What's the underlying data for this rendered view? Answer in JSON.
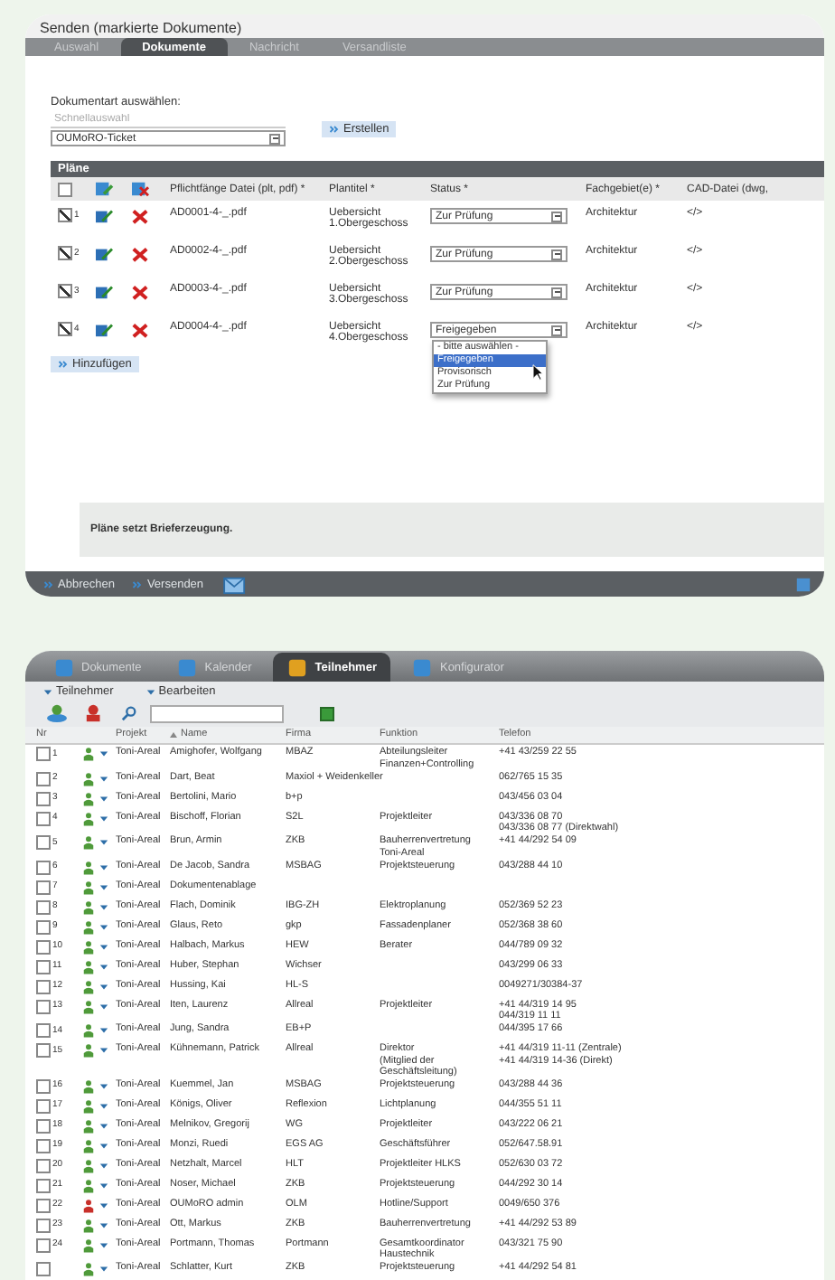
{
  "send_dialog": {
    "title": "Senden (markierte Dokumente)",
    "tabs": [
      {
        "label": "Auswahl",
        "selected": false
      },
      {
        "label": "Dokumente",
        "selected": true
      },
      {
        "label": "Nachricht",
        "selected": false
      },
      {
        "label": "Versandliste",
        "selected": false
      }
    ],
    "doc_type_label": "Dokumentart auswählen:",
    "quick_select": {
      "placeholder": "Schnellauswahl"
    },
    "doc_type_value": "OUMoRO-Ticket",
    "create_button": "Erstellen",
    "plans": {
      "title": "Pläne",
      "select_all_checked": false,
      "columns": [
        "Pflichtfänge Datei (plt, pdf) *",
        "Plantitel *",
        "Status *",
        "Fachgebiet(e) *",
        "CAD-Datei (dwg,"
      ],
      "rows": [
        {
          "checked": true,
          "nr": "1",
          "file": "AD0001-4-_.pdf",
          "title": [
            "Uebersicht",
            "1.Obergeschoss"
          ],
          "status": "Zur Prüfung",
          "field": "Architektur",
          "cad": "</>"
        },
        {
          "checked": true,
          "nr": "2",
          "file": "AD0002-4-_.pdf",
          "title": [
            "Uebersicht",
            "2.Obergeschoss"
          ],
          "status": "Zur Prüfung",
          "field": "Architektur",
          "cad": "</>"
        },
        {
          "checked": true,
          "nr": "3",
          "file": "AD0003-4-_.pdf",
          "title": [
            "Uebersicht",
            "3.Obergeschoss"
          ],
          "status": "Zur Prüfung",
          "field": "Architektur",
          "cad": "</>"
        },
        {
          "checked": true,
          "nr": "4",
          "file": "AD0004-4-_.pdf",
          "title": [
            "Uebersicht",
            "4.Obergeschoss"
          ],
          "status": "Freigegeben",
          "field": "Architektur",
          "cad": "</>"
        }
      ],
      "open_dropdown": {
        "options": [
          {
            "label": "- bitte auswählen -",
            "selected": false
          },
          {
            "label": "Freigegeben",
            "selected": true
          },
          {
            "label": "Provisorisch",
            "selected": false
          },
          {
            "label": "Zur Prüfung",
            "selected": false
          }
        ]
      },
      "add_button": "Hinzufügen"
    },
    "note": "Pläne setzt Brieferzeugung.",
    "footer_buttons": [
      "Abbrechen",
      "Versenden"
    ]
  },
  "participants": {
    "tabs": [
      {
        "label": "Dokumente",
        "selected": false
      },
      {
        "label": "Kalender",
        "selected": false
      },
      {
        "label": "Teilnehmer",
        "selected": true
      },
      {
        "label": "Konfigurator",
        "selected": false
      }
    ],
    "menus": [
      "Teilnehmer",
      "Bearbeiten"
    ],
    "columns": [
      "Nr",
      "Projekt",
      "Name",
      "Firma",
      "Funktion",
      "Telefon"
    ],
    "rows": [
      {
        "checked": false,
        "nr": "1",
        "color": "#4f9a3a",
        "project": "Toni-Areal",
        "name": "Amighofer, Wolfgang",
        "company": "MBAZ",
        "function": [
          "Abteilungsleiter",
          "Finanzen+Controlling"
        ],
        "phone": [
          "+41 43/259 22 55"
        ]
      },
      {
        "checked": false,
        "nr": "2",
        "color": "#4f9a3a",
        "project": "Toni-Areal",
        "name": "Dart, Beat",
        "company": "Maxiol + Weidenkeller",
        "function": [],
        "phone": [
          "062/765 15 35"
        ]
      },
      {
        "checked": false,
        "nr": "3",
        "color": "#4f9a3a",
        "project": "Toni-Areal",
        "name": "Bertolini, Mario",
        "company": "b+p",
        "function": [],
        "phone": [
          "043/456 03 04"
        ]
      },
      {
        "checked": false,
        "nr": "4",
        "color": "#4f9a3a",
        "project": "Toni-Areal",
        "name": "Bischoff, Florian",
        "company": "S2L",
        "function": [
          "Projektleiter"
        ],
        "phone": [
          "043/336 08 70",
          "043/336 08 77 (Direktwahl)"
        ]
      },
      {
        "checked": false,
        "nr": "5",
        "color": "#4f9a3a",
        "project": "Toni-Areal",
        "name": "Brun, Armin",
        "company": "ZKB",
        "function": [
          "Bauherrenvertretung",
          "Toni-Areal"
        ],
        "phone": [
          "+41 44/292 54 09"
        ]
      },
      {
        "checked": false,
        "nr": "6",
        "color": "#4f9a3a",
        "project": "Toni-Areal",
        "name": "De Jacob, Sandra",
        "company": "MSBAG",
        "function": [
          "Projektsteuerung"
        ],
        "phone": [
          "043/288 44 10"
        ]
      },
      {
        "checked": false,
        "nr": "7",
        "color": "#4f9a3a",
        "project": "Toni-Areal",
        "name": "Dokumentenablage",
        "company": "",
        "function": [],
        "phone": []
      },
      {
        "checked": false,
        "nr": "8",
        "color": "#4f9a3a",
        "project": "Toni-Areal",
        "name": "Flach, Dominik",
        "company": "IBG-ZH",
        "function": [
          "Elektroplanung"
        ],
        "phone": [
          "052/369 52 23"
        ]
      },
      {
        "checked": false,
        "nr": "9",
        "color": "#4f9a3a",
        "project": "Toni-Areal",
        "name": "Glaus, Reto",
        "company": "gkp",
        "function": [
          "Fassadenplaner"
        ],
        "phone": [
          "052/368 38 60"
        ]
      },
      {
        "checked": false,
        "nr": "10",
        "color": "#4f9a3a",
        "project": "Toni-Areal",
        "name": "Halbach, Markus",
        "company": "HEW",
        "function": [
          "Berater"
        ],
        "phone": [
          "044/789 09 32"
        ]
      },
      {
        "checked": false,
        "nr": "11",
        "color": "#4f9a3a",
        "project": "Toni-Areal",
        "name": "Huber, Stephan",
        "company": "Wichser",
        "function": [],
        "phone": [
          "043/299 06 33"
        ]
      },
      {
        "checked": false,
        "nr": "12",
        "color": "#4f9a3a",
        "project": "Toni-Areal",
        "name": "Hussing, Kai",
        "company": "HL-S",
        "function": [],
        "phone": [
          "0049271/30384-37"
        ]
      },
      {
        "checked": false,
        "nr": "13",
        "color": "#4f9a3a",
        "project": "Toni-Areal",
        "name": "Iten, Laurenz",
        "company": "Allreal",
        "function": [
          "Projektleiter"
        ],
        "phone": [
          "+41 44/319 14 95",
          "044/319 11 11"
        ]
      },
      {
        "checked": false,
        "nr": "14",
        "color": "#4f9a3a",
        "project": "Toni-Areal",
        "name": "Jung, Sandra",
        "company": "EB+P",
        "function": [],
        "phone": [
          "044/395 17 66"
        ]
      },
      {
        "checked": false,
        "nr": "15",
        "color": "#4f9a3a",
        "project": "Toni-Areal",
        "name": "Kühnemann, Patrick",
        "company": "Allreal",
        "function": [
          "Direktor",
          "(Mitglied der",
          "Geschäftsleitung)"
        ],
        "phone": [
          "+41 44/319 11-11 (Zentrale)",
          "+41 44/319 14-36 (Direkt)"
        ]
      },
      {
        "checked": false,
        "nr": "16",
        "color": "#4f9a3a",
        "project": "Toni-Areal",
        "name": "Kuemmel, Jan",
        "company": "MSBAG",
        "function": [
          "Projektsteuerung"
        ],
        "phone": [
          "043/288 44 36"
        ]
      },
      {
        "checked": false,
        "nr": "17",
        "color": "#4f9a3a",
        "project": "Toni-Areal",
        "name": "Königs, Oliver",
        "company": "Reflexion",
        "function": [
          "Lichtplanung"
        ],
        "phone": [
          "044/355 51 11"
        ]
      },
      {
        "checked": false,
        "nr": "18",
        "color": "#4f9a3a",
        "project": "Toni-Areal",
        "name": "Melnikov, Gregorij",
        "company": "WG",
        "function": [
          "Projektleiter"
        ],
        "phone": [
          "043/222 06 21"
        ]
      },
      {
        "checked": false,
        "nr": "19",
        "color": "#4f9a3a",
        "project": "Toni-Areal",
        "name": "Monzi, Ruedi",
        "company": "EGS AG",
        "function": [
          "Geschäftsführer"
        ],
        "phone": [
          "052/647.58.91"
        ]
      },
      {
        "checked": false,
        "nr": "20",
        "color": "#4f9a3a",
        "project": "Toni-Areal",
        "name": "Netzhalt, Marcel",
        "company": "HLT",
        "function": [
          "Projektleiter HLKS"
        ],
        "phone": [
          "052/630 03 72"
        ]
      },
      {
        "checked": false,
        "nr": "21",
        "color": "#4f9a3a",
        "project": "Toni-Areal",
        "name": "Noser, Michael",
        "company": "ZKB",
        "function": [
          "Projektsteuerung"
        ],
        "phone": [
          "044/292 30 14"
        ]
      },
      {
        "checked": false,
        "nr": "22",
        "color": "#c8302a",
        "project": "Toni-Areal",
        "name": "OUMoRO admin",
        "company": "OLM",
        "function": [
          "Hotline/Support"
        ],
        "phone": [
          "0049/650 376"
        ]
      },
      {
        "checked": false,
        "nr": "23",
        "color": "#4f9a3a",
        "project": "Toni-Areal",
        "name": "Ott, Markus",
        "company": "ZKB",
        "function": [
          "Bauherrenvertretung"
        ],
        "phone": [
          "+41 44/292 53 89"
        ]
      },
      {
        "checked": false,
        "nr": "24",
        "color": "#4f9a3a",
        "project": "Toni-Areal",
        "name": "Portmann, Thomas",
        "company": "Portmann",
        "function": [
          "Gesamtkoordinator",
          "Haustechnik"
        ],
        "phone": [
          "043/321 75 90"
        ]
      },
      {
        "checked": false,
        "color": "#4f9a3a",
        "project": "Toni-Areal",
        "name": "Schlatter, Kurt",
        "company": "ZKB",
        "function": [
          "Projektsteuerung"
        ],
        "phone": [
          "+41 44/292 54 81"
        ]
      }
    ]
  }
}
